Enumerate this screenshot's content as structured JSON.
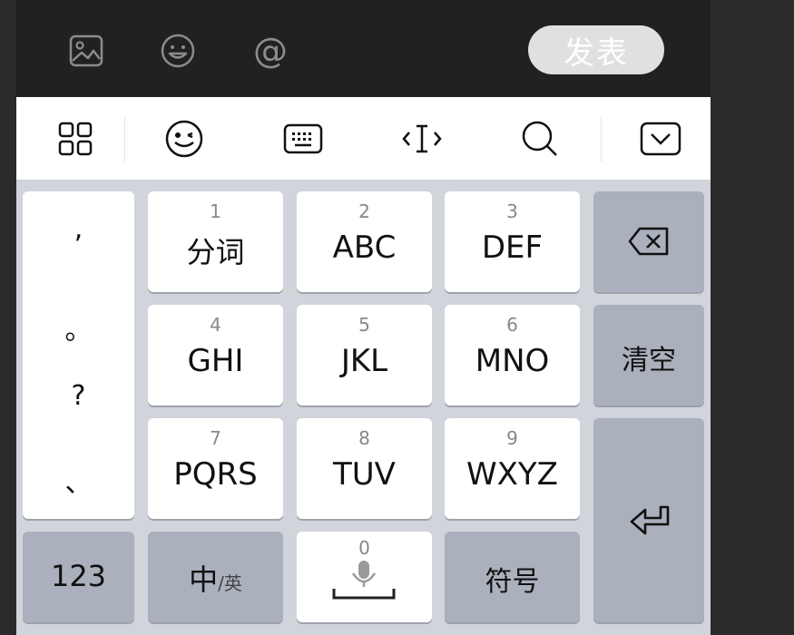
{
  "composer": {
    "icons": [
      "image-icon",
      "smile-icon",
      "at-icon"
    ],
    "at_glyph": "@",
    "send_label": "发表"
  },
  "toolbar": {
    "icons": [
      "grid-icon",
      "emoji-icon",
      "keyboard-icon",
      "cursor-icon",
      "search-icon",
      "hide-keyboard-icon"
    ]
  },
  "keyboard": {
    "punctuation": [
      ",",
      "。",
      "?",
      "、"
    ],
    "keys": [
      {
        "num": "1",
        "label": "分词"
      },
      {
        "num": "2",
        "label": "ABC"
      },
      {
        "num": "3",
        "label": "DEF"
      },
      {
        "num": "4",
        "label": "GHI"
      },
      {
        "num": "5",
        "label": "JKL"
      },
      {
        "num": "6",
        "label": "MNO"
      },
      {
        "num": "7",
        "label": "PQRS"
      },
      {
        "num": "8",
        "label": "TUV"
      },
      {
        "num": "9",
        "label": "WXYZ"
      }
    ],
    "clear_label": "清空",
    "numbers_label": "123",
    "lang_main": "中",
    "lang_sub": "/英",
    "space_num": "0",
    "symbols_label": "符号"
  },
  "colors": {
    "composer_bg": "#212121",
    "send_button_bg": "#e0e0e0",
    "keyboard_bg": "#d1d4db",
    "key_bg": "#ffffff",
    "function_key_bg": "#aab0bc"
  }
}
